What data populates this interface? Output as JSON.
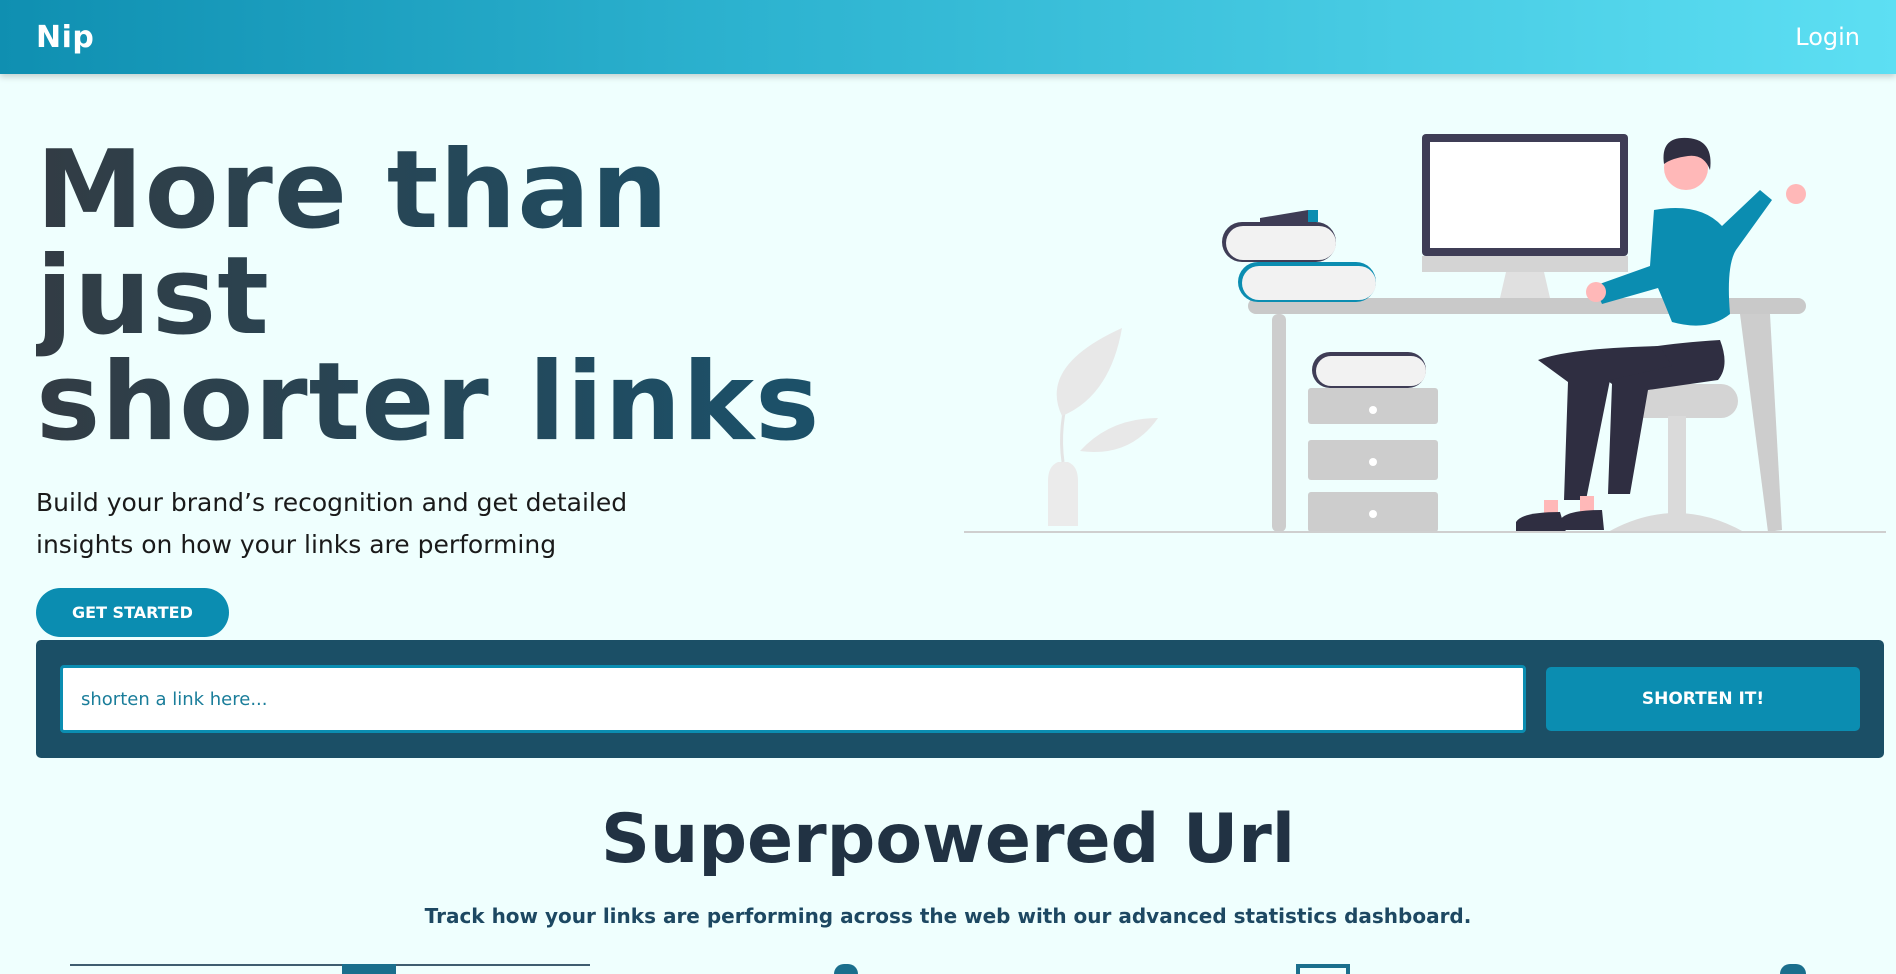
{
  "navbar": {
    "brand": "Nip",
    "login_label": "Login"
  },
  "hero": {
    "title_line1": "More than just",
    "title_line2": "shorter links",
    "description_line1": "Build your brand’s recognition and get detailed",
    "description_line2": "insights on how your links are performing",
    "cta_label": "GET STARTED"
  },
  "shortener": {
    "placeholder": "shorten a link here...",
    "button_label": "SHORTEN IT!"
  },
  "features": {
    "title": "Superpowered Url",
    "subtitle": "Track how your links are performing across the web with our advanced statistics dashboard."
  },
  "colors": {
    "primary": "#0b8db1",
    "dark": "#1b4f66",
    "background": "#effffe",
    "heading": "#213243"
  }
}
